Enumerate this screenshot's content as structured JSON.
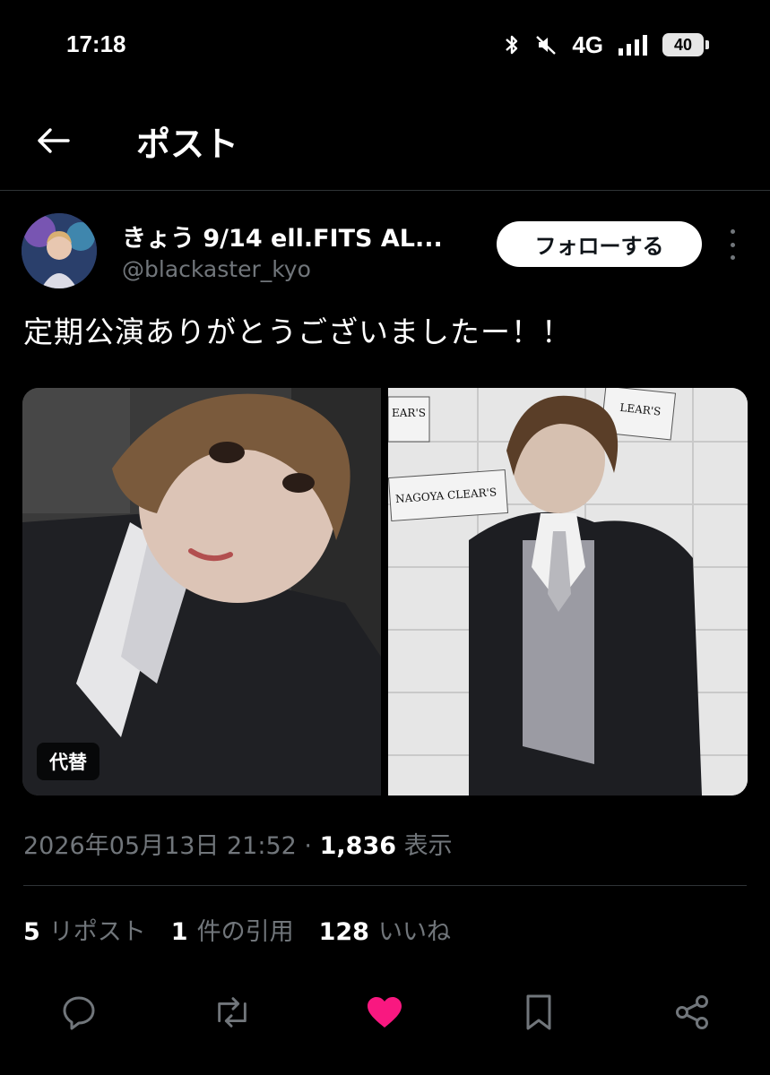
{
  "status_bar": {
    "time": "17:18",
    "network": "4G",
    "battery": "40"
  },
  "header": {
    "title": "ポスト"
  },
  "author": {
    "display_name": "きょう 9/14 ell.FITS AL...",
    "handle": "@blackaster_kyo",
    "follow_label": "フォローする"
  },
  "tweet": {
    "text": "定期公演ありがとうございましたー！！",
    "alt_badge": "代替",
    "photo_left_sign": "",
    "photo_right_sign_1": "NAGOYA CLEAR'S",
    "photo_right_sign_2": "EAR'S",
    "photo_right_sign_3": "LEAR'S"
  },
  "meta": {
    "timestamp": "2026年05月13日 21:52",
    "separator": "·",
    "views": "1,836",
    "views_label": "表示"
  },
  "stats": {
    "reposts": "5",
    "reposts_label": "リポスト",
    "quotes": "1",
    "quotes_label": "件の引用",
    "likes": "128",
    "likes_label": "いいね"
  },
  "icons": {
    "like_color": "#f91880"
  }
}
